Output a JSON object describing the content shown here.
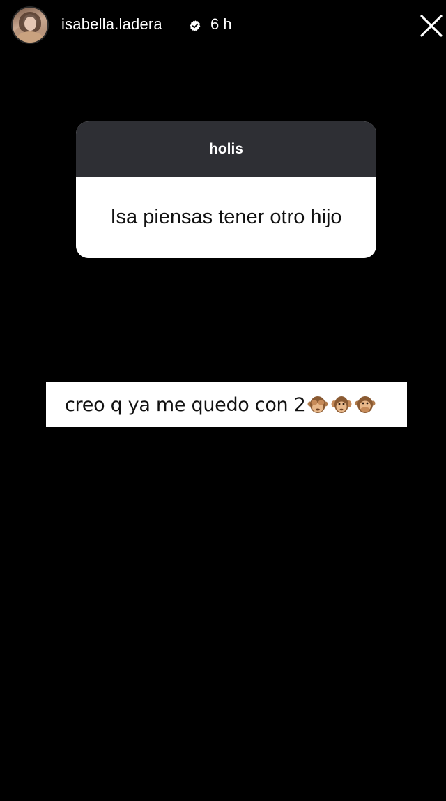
{
  "header": {
    "username": "isabella.ladera",
    "timestamp": "6 h",
    "verified": true,
    "avatar": "profile-photo",
    "close_icon": "close-icon"
  },
  "question_sticker": {
    "header": "holis",
    "question": "Isa piensas tener otro hijo"
  },
  "answer": {
    "text": "creo q ya me quedo con 2",
    "emojis": [
      "see-no-evil-monkey",
      "hear-no-evil-monkey",
      "speak-no-evil-monkey"
    ]
  },
  "colors": {
    "background": "#000000",
    "sticker_header": "#2e2f34",
    "sticker_body": "#ffffff",
    "verified_badge": "#ffffff"
  }
}
